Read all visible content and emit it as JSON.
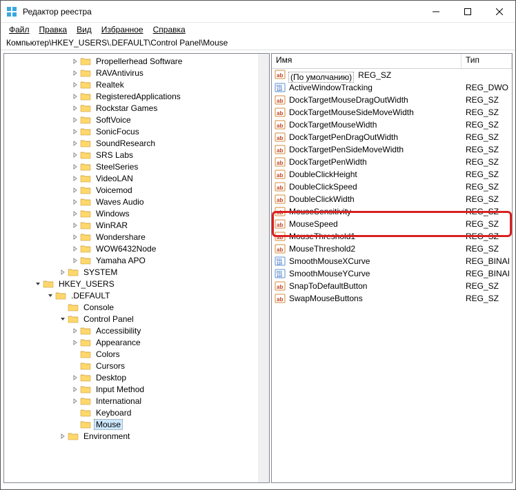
{
  "window": {
    "title": "Редактор реестра"
  },
  "menu": {
    "file": "Файл",
    "edit": "Правка",
    "view": "Вид",
    "favorites": "Избранное",
    "help": "Справка"
  },
  "address": "Компьютер\\HKEY_USERS\\.DEFAULT\\Control Panel\\Mouse",
  "tree": [
    {
      "indent": 4,
      "exp": "closed",
      "label": "Propellerhead Software"
    },
    {
      "indent": 4,
      "exp": "closed",
      "label": "RAVAntivirus"
    },
    {
      "indent": 4,
      "exp": "closed",
      "label": "Realtek"
    },
    {
      "indent": 4,
      "exp": "closed",
      "label": "RegisteredApplications"
    },
    {
      "indent": 4,
      "exp": "closed",
      "label": "Rockstar Games"
    },
    {
      "indent": 4,
      "exp": "closed",
      "label": "SoftVoice"
    },
    {
      "indent": 4,
      "exp": "closed",
      "label": "SonicFocus"
    },
    {
      "indent": 4,
      "exp": "closed",
      "label": "SoundResearch"
    },
    {
      "indent": 4,
      "exp": "closed",
      "label": "SRS Labs"
    },
    {
      "indent": 4,
      "exp": "closed",
      "label": "SteelSeries"
    },
    {
      "indent": 4,
      "exp": "closed",
      "label": "VideoLAN"
    },
    {
      "indent": 4,
      "exp": "closed",
      "label": "Voicemod"
    },
    {
      "indent": 4,
      "exp": "closed",
      "label": "Waves Audio"
    },
    {
      "indent": 4,
      "exp": "closed",
      "label": "Windows"
    },
    {
      "indent": 4,
      "exp": "closed",
      "label": "WinRAR"
    },
    {
      "indent": 4,
      "exp": "closed",
      "label": "Wondershare"
    },
    {
      "indent": 4,
      "exp": "closed",
      "label": "WOW6432Node"
    },
    {
      "indent": 4,
      "exp": "closed",
      "label": "Yamaha APO"
    },
    {
      "indent": 3,
      "exp": "closed",
      "label": "SYSTEM"
    },
    {
      "indent": 1,
      "exp": "open",
      "label": "HKEY_USERS"
    },
    {
      "indent": 2,
      "exp": "open",
      "label": ".DEFAULT"
    },
    {
      "indent": 3,
      "exp": "none",
      "label": "Console"
    },
    {
      "indent": 3,
      "exp": "open",
      "label": "Control Panel"
    },
    {
      "indent": 4,
      "exp": "closed",
      "label": "Accessibility"
    },
    {
      "indent": 4,
      "exp": "closed",
      "label": "Appearance"
    },
    {
      "indent": 4,
      "exp": "none",
      "label": "Colors"
    },
    {
      "indent": 4,
      "exp": "none",
      "label": "Cursors"
    },
    {
      "indent": 4,
      "exp": "closed",
      "label": "Desktop"
    },
    {
      "indent": 4,
      "exp": "closed",
      "label": "Input Method"
    },
    {
      "indent": 4,
      "exp": "closed",
      "label": "International"
    },
    {
      "indent": 4,
      "exp": "none",
      "label": "Keyboard"
    },
    {
      "indent": 4,
      "exp": "none",
      "label": "Mouse",
      "selected": true
    },
    {
      "indent": 3,
      "exp": "closed",
      "label": "Environment"
    }
  ],
  "list_header": {
    "name": "Имя",
    "type": "Тип"
  },
  "values": [
    {
      "name": "(По умолчанию)",
      "type": "REG_SZ",
      "icon": "str",
      "default": true
    },
    {
      "name": "ActiveWindowTracking",
      "type": "REG_DWO",
      "icon": "bin"
    },
    {
      "name": "DockTargetMouseDragOutWidth",
      "type": "REG_SZ",
      "icon": "str"
    },
    {
      "name": "DockTargetMouseSideMoveWidth",
      "type": "REG_SZ",
      "icon": "str"
    },
    {
      "name": "DockTargetMouseWidth",
      "type": "REG_SZ",
      "icon": "str"
    },
    {
      "name": "DockTargetPenDragOutWidth",
      "type": "REG_SZ",
      "icon": "str"
    },
    {
      "name": "DockTargetPenSideMoveWidth",
      "type": "REG_SZ",
      "icon": "str"
    },
    {
      "name": "DockTargetPenWidth",
      "type": "REG_SZ",
      "icon": "str"
    },
    {
      "name": "DoubleClickHeight",
      "type": "REG_SZ",
      "icon": "str"
    },
    {
      "name": "DoubleClickSpeed",
      "type": "REG_SZ",
      "icon": "str"
    },
    {
      "name": "DoubleClickWidth",
      "type": "REG_SZ",
      "icon": "str"
    },
    {
      "name": "MouseSensitivity",
      "type": "REG_SZ",
      "icon": "str"
    },
    {
      "name": "MouseSpeed",
      "type": "REG_SZ",
      "icon": "str"
    },
    {
      "name": "MouseThreshold1",
      "type": "REG_SZ",
      "icon": "str"
    },
    {
      "name": "MouseThreshold2",
      "type": "REG_SZ",
      "icon": "str"
    },
    {
      "name": "SmoothMouseXCurve",
      "type": "REG_BINAI",
      "icon": "bin"
    },
    {
      "name": "SmoothMouseYCurve",
      "type": "REG_BINAI",
      "icon": "bin"
    },
    {
      "name": "SnapToDefaultButton",
      "type": "REG_SZ",
      "icon": "str"
    },
    {
      "name": "SwapMouseButtons",
      "type": "REG_SZ",
      "icon": "str"
    }
  ],
  "highlight_index": 12
}
